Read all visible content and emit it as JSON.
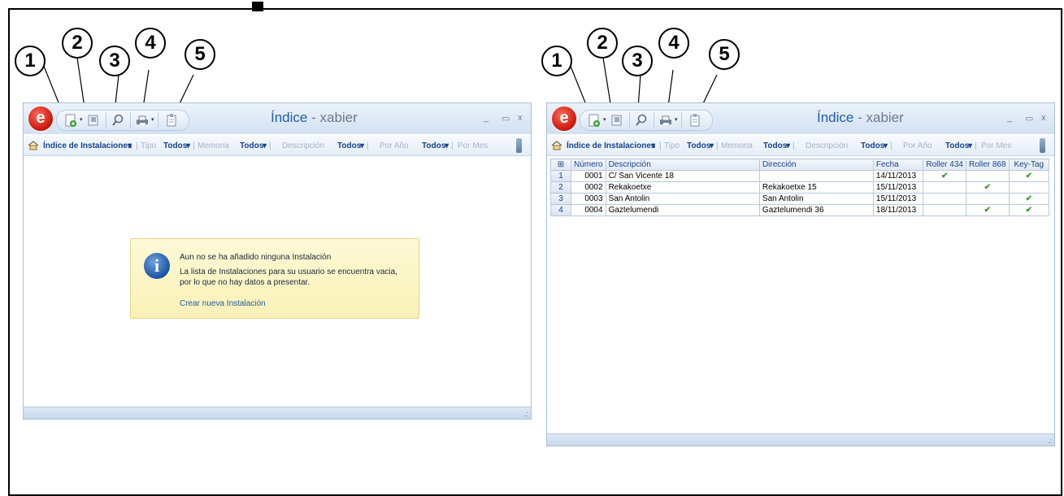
{
  "callouts": [
    "1",
    "2",
    "3",
    "4",
    "5"
  ],
  "app": {
    "logo_letter": "e",
    "title": "Índice",
    "title_separator": " - ",
    "user": "xabier",
    "minimize": "_",
    "maximize": "▭",
    "close": "x"
  },
  "toolbar": {
    "index_label": "Índice de Instalaciones",
    "dropdown": "▾",
    "tipo_label": "Tipo",
    "memoria_label": "Memoria",
    "descripcion_label": "Descripción",
    "por_anio_label": "Por Año",
    "por_mes_label": "Por Mes",
    "todos_label": "Todos",
    "separator": "|"
  },
  "empty_state": {
    "title": "Aun no se ha añadido ninguna Instalación",
    "message": "La lista de Instalaciones para su usuario se encuentra vacia, por lo que no hay datos a presentar.",
    "link": "Crear nueva Instalación"
  },
  "grid": {
    "columns": [
      "Número",
      "Descripción",
      "Dirección",
      "Fecha",
      "Roller 434",
      "Roller 868",
      "Key-Tag"
    ],
    "check_mark": "✔",
    "rows": [
      {
        "row": "1",
        "numero": "0001",
        "descripcion": "C/ San Vicente 18",
        "direccion": "",
        "fecha": "14/11/2013",
        "roller434": true,
        "roller868": false,
        "keytag": true
      },
      {
        "row": "2",
        "numero": "0002",
        "descripcion": "Rekakoetxe",
        "direccion": "Rekakoetxe 15",
        "fecha": "15/11/2013",
        "roller434": false,
        "roller868": true,
        "keytag": false
      },
      {
        "row": "3",
        "numero": "0003",
        "descripcion": "San Antolin",
        "direccion": "San Antolin",
        "fecha": "15/11/2013",
        "roller434": false,
        "roller868": false,
        "keytag": true
      },
      {
        "row": "4",
        "numero": "0004",
        "descripcion": "Gaztelumendi",
        "direccion": "Gaztelumendi 36",
        "fecha": "18/11/2013",
        "roller434": false,
        "roller868": true,
        "keytag": true
      }
    ]
  },
  "colors": {
    "accent": "#15428b",
    "title_blue": "#1f5fa8",
    "check_green": "#3a9a2a",
    "info_bg": "#faf1b6"
  },
  "icons": [
    "new-document-icon",
    "open-icon",
    "search-icon",
    "print-icon",
    "clipboard-icon",
    "home-icon",
    "info-icon",
    "resize-grip-icon"
  ]
}
